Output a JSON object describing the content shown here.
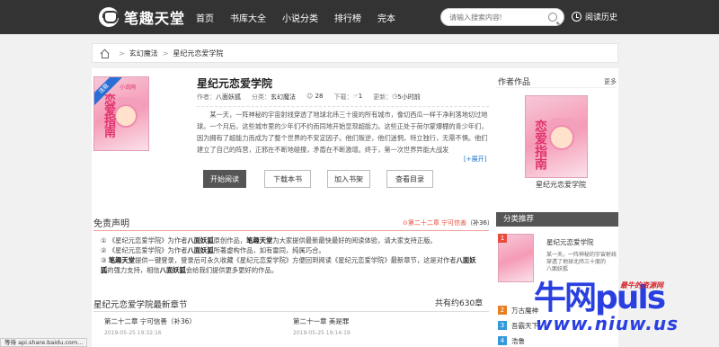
{
  "site": {
    "name": "笔趣天堂"
  },
  "nav": [
    "首页",
    "书库大全",
    "小说分类",
    "排行榜",
    "完本"
  ],
  "search": {
    "placeholder": "请输入搜索内容!"
  },
  "history_label": "阅读历史",
  "breadcrumb": {
    "category": "玄幻魔法",
    "book": "星纪元恋爱学院"
  },
  "book": {
    "title": "星纪元恋爱学院",
    "author_label": "作者：",
    "author": "八面妖狐",
    "category_label": "分类：",
    "category": "玄幻魔法",
    "likes": "28",
    "download_label": "下载：",
    "downloads": "1",
    "update_label": "更新：",
    "update_time": "5小时前",
    "cover_publisher": "小说网",
    "cover_ribbon": "连载",
    "cover_title": "恋爱指南",
    "description": "某一天，一阵神秘的宇宙射线穿透了地球北纬三十度的所有城市，像切西瓜一样干净利落地切过地球。一个月后，这些城市里的少年们不约而同地开始显现超能力。这些正处于荷尔蒙爆棚的青少年们，因为拥有了超能力而成为了整个世界的不安定因子。他们叛逆，他们迷惘，特立独行，无需不惧。他们建立了自己的阵营，正邪在不断地碰撞，矛盾在不断激增。终于，第一次世界异能大战发",
    "expand_label": "[+展开]"
  },
  "buttons": {
    "read": "开始阅读",
    "download": "下载本书",
    "bookshelf": "加入书架",
    "catalog": "查看目录"
  },
  "author_works": {
    "title": "作者作品",
    "more": "更多",
    "book": "星纪元恋爱学院"
  },
  "disclaimer": {
    "title": "免责声明",
    "tip_prefix": "⊙第二十二章 宁可信善",
    "tip_suffix": "（补36）",
    "line1_a": "《星纪元恋爱学院》为作者",
    "line1_author": "八面妖狐",
    "line1_b": "原创作品，",
    "line1_site": "笔趣天堂",
    "line1_c": "为大家提供最新最快最好的阅读体验，请大家支持正版。",
    "line2_a": "《星纪元恋爱学院》为作者",
    "line2_author": "八面妖狐",
    "line2_b": "所著虚构作品，如有雷同，纯属巧合。",
    "line3_site": "笔趣天堂",
    "line3_a": "提供一键登录，登录后可永久收藏《星纪元恋爱学院》方便回到阅读《星纪元恋爱学院》最新章节，这是对作者",
    "line3_author": "八面妖狐",
    "line3_b": "的强力支持，相信",
    "line3_author2": "八面妖狐",
    "line3_c": "会给我们提供更多更好的作品。"
  },
  "category_rec": {
    "title": "分类推荐",
    "book": "星纪元恋爱学院",
    "desc": "某一天，一阵神秘的宇宙射线穿透了地球北纬三十度的",
    "author_tag": "八面妖狐",
    "rank": [
      {
        "num": "2",
        "title": "万古魔神",
        "color": "#e67e22"
      },
      {
        "num": "3",
        "title": "吾霸天下",
        "color": "#3498db"
      },
      {
        "num": "4",
        "title": "浩鲁",
        "color": "#3498db"
      }
    ]
  },
  "chapters": {
    "title": "星纪元恋爱学院最新章节",
    "count": "共有约630章",
    "list": [
      {
        "title": "第二十二章 宁可信善（补36）",
        "date": "2019-05-25 19:32:16"
      },
      {
        "title": "第二十一章 美是罪",
        "date": "2019-05-25 19:14:19"
      }
    ]
  },
  "watermark": {
    "big": "牛网puls",
    "small": "最牛的资源网",
    "url": "www.niuw.us"
  },
  "status": "等待 api.share.baidu.com..."
}
